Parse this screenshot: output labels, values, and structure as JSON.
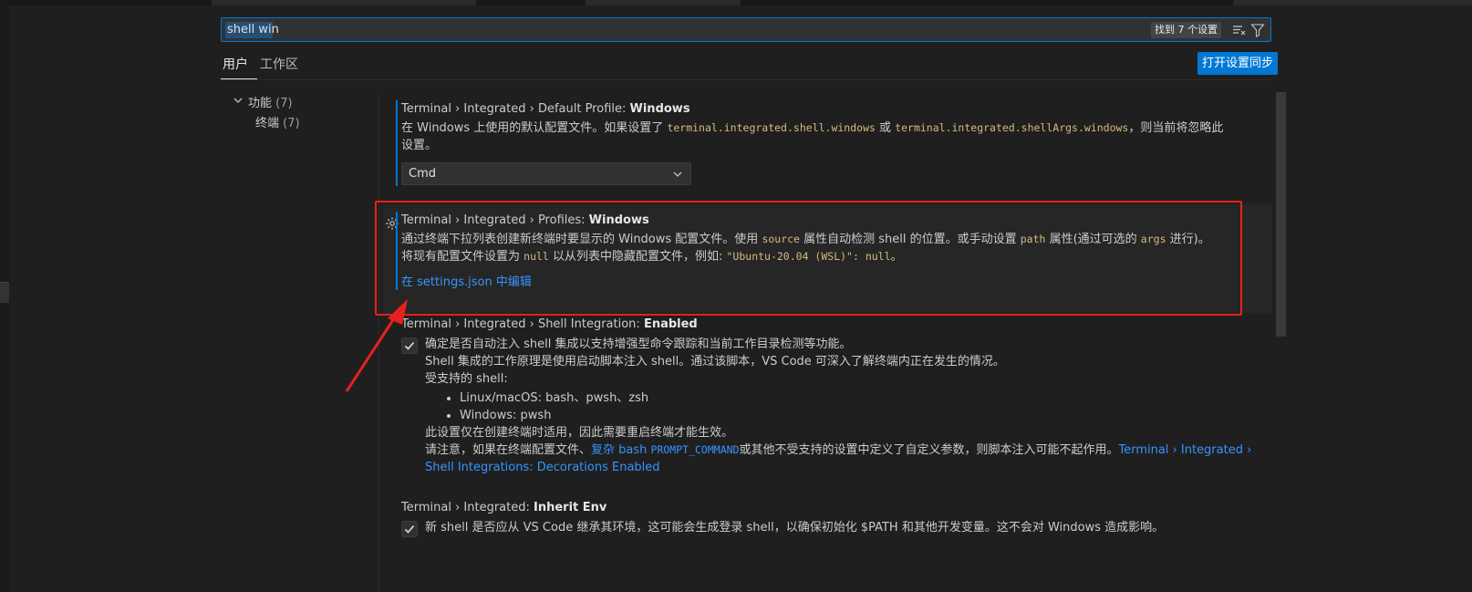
{
  "search": {
    "value": "shell win",
    "result_count": "找到 7 个设置"
  },
  "tabs": [
    {
      "label": "用户",
      "active": true
    },
    {
      "label": "工作区",
      "active": false
    }
  ],
  "sync_button": "打开设置同步",
  "toc": {
    "group": "功能",
    "group_count": "(7)",
    "item": "终端",
    "item_count": "(7)"
  },
  "settings": {
    "default_profile": {
      "title_prefix": "Terminal › Integrated › Default Profile: ",
      "title_bold": "Windows",
      "desc_1": "在 Windows 上使用的默认配置文件。如果设置了 ",
      "code_1": "terminal.integrated.shell.windows",
      "desc_2": " 或 ",
      "code_2": "terminal.integrated.shellArgs.windows",
      "desc_3": "，则当前将忽略此设置。",
      "dropdown_value": "Cmd"
    },
    "profiles": {
      "title_prefix": "Terminal › Integrated › Profiles: ",
      "title_bold": "Windows",
      "desc_1": "通过终端下拉列表创建新终端时要显示的 Windows 配置文件。使用 ",
      "code_1": "source",
      "desc_2": " 属性自动检测 shell 的位置。或手动设置 ",
      "code_2": "path",
      "desc_3": " 属性(通过可选的 ",
      "code_3": "args",
      "desc_4": " 进行)。",
      "desc_5": "将现有配置文件设置为 ",
      "code_4": "null",
      "desc_6": " 以从列表中隐藏配置文件，例如: ",
      "code_5": "\"Ubuntu-20.04 (WSL)\": null",
      "desc_7": "。",
      "link": "在 settings.json 中编辑"
    },
    "shell_integration": {
      "title_prefix": "Terminal › Integrated › Shell Integration: ",
      "title_bold": "Enabled",
      "checked": true,
      "line_1": "确定是否自动注入 shell 集成以支持增强型命令跟踪和当前工作目录检测等功能。",
      "line_2": "Shell 集成的工作原理是使用启动脚本注入 shell。通过该脚本，VS Code 可深入了解终端内正在发生的情况。",
      "line_3": "受支持的 shell:",
      "bullet_1": "Linux/macOS: bash、pwsh、zsh",
      "bullet_2": "Windows: pwsh",
      "line_4": "此设置仅在创建终端时适用，因此需要重启终端才能生效。",
      "line_5a": "请注意，如果在终端配置文件、",
      "link_1": "复杂 bash",
      "code_1": "PROMPT_COMMAND",
      "line_5b": "或其他不受支持的设置中定义了自定义参数，则脚本注入可能不起作用。",
      "link_2a": "Terminal › Integrated ›",
      "link_2b": "Shell Integrations: Decorations Enabled"
    },
    "inherit_env": {
      "title_prefix": "Terminal › Integrated: ",
      "title_bold": "Inherit Env",
      "checked": true,
      "desc": "新 shell 是否应从 VS Code 继承其环境，这可能会生成登录 shell，以确保初始化 $PATH 和其他开发变量。这不会对 Windows 造成影响。"
    }
  },
  "colors": {
    "accent": "#0078d4",
    "link": "#3794ff",
    "code": "#d7ba7d",
    "annotation": "#e8201d"
  },
  "icons": {
    "clear_filter": "clear-filter-icon",
    "filter": "filter-icon",
    "gear": "gear-icon",
    "chevron": "chevron-down-icon",
    "check": "check-icon"
  }
}
